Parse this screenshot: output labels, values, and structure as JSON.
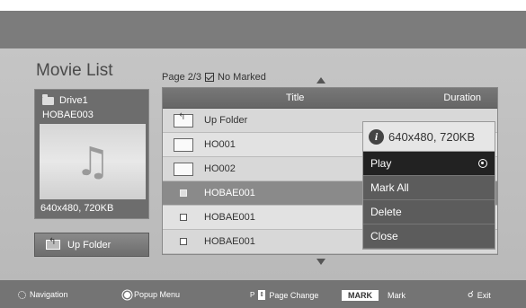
{
  "header": {
    "title": "Movie List",
    "page": "Page 2/3",
    "marked": "No Marked"
  },
  "drive": {
    "name": "Drive1",
    "code": "HOBAE003",
    "resolution": "640x480, 720KB",
    "thumbnail_icon": "music-note-icon"
  },
  "up_folder_button": "Up Folder",
  "list": {
    "columns": {
      "title": "Title",
      "duration": "Duration"
    },
    "rows": [
      {
        "name": "Up Folder",
        "icon": "up-folder-icon"
      },
      {
        "name": "HO001",
        "icon": "folder-icon"
      },
      {
        "name": "HO002",
        "icon": "folder-icon"
      },
      {
        "name": "HOBAE001",
        "icon": "file-icon"
      },
      {
        "name": "HOBAE001",
        "icon": "file-icon"
      },
      {
        "name": "HOBAE001",
        "icon": "file-icon"
      }
    ]
  },
  "popup": {
    "info": "640x480, 720KB",
    "items": [
      "Play",
      "Mark All",
      "Delete",
      "Close"
    ]
  },
  "footer": {
    "navigation": "Navigation",
    "popup_menu": "Popup Menu",
    "page_change": "Page Change",
    "mark_key": "MARK",
    "mark": "Mark",
    "exit": "Exit"
  }
}
